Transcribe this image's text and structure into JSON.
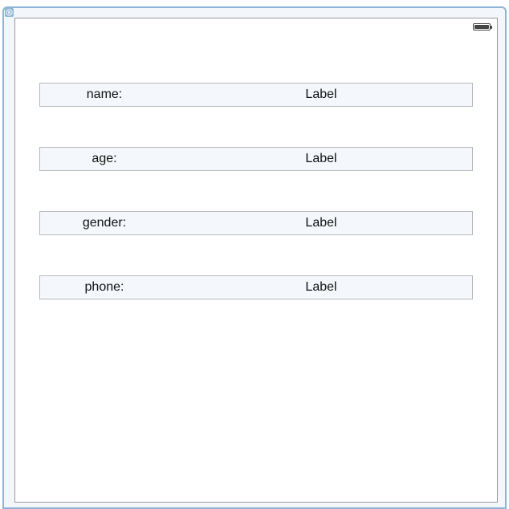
{
  "window": {
    "close_icon": "close-icon"
  },
  "status_bar": {
    "battery_icon": "battery-icon"
  },
  "rows": [
    {
      "key": "name:",
      "value": "Label"
    },
    {
      "key": "age:",
      "value": "Label"
    },
    {
      "key": "gender:",
      "value": "Label"
    },
    {
      "key": "phone:",
      "value": "Label"
    }
  ],
  "colors": {
    "frame": "#8fb4d8",
    "row_background": "#f4f7fb",
    "row_border": "#b9b9b9",
    "text": "#111111"
  }
}
